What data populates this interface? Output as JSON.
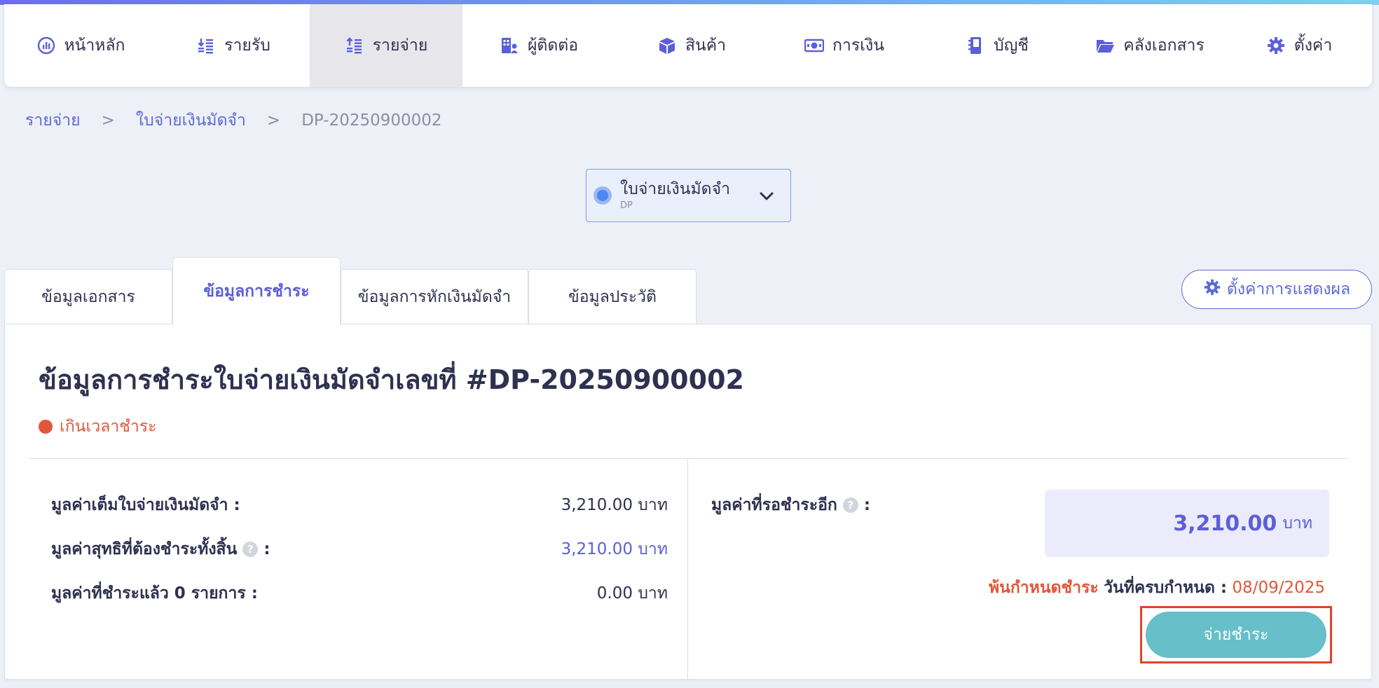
{
  "colors": {
    "accent": "#5b5fd9",
    "link": "#5b6ad6",
    "overdue": "#e0573a",
    "pay_button": "#67bfc9",
    "highlight_frame": "#e0442a",
    "active_nav_bg": "#e6e6eb"
  },
  "nav": {
    "items": [
      {
        "label": "หน้าหลัก",
        "icon": "dashboard-icon"
      },
      {
        "label": "รายรับ",
        "icon": "income-icon"
      },
      {
        "label": "รายจ่าย",
        "icon": "expense-icon",
        "active": true
      },
      {
        "label": "ผู้ติดต่อ",
        "icon": "contacts-icon"
      },
      {
        "label": "สินค้า",
        "icon": "product-box-icon"
      },
      {
        "label": "การเงิน",
        "icon": "money-icon"
      },
      {
        "label": "บัญชี",
        "icon": "account-book-icon"
      },
      {
        "label": "คลังเอกสาร",
        "icon": "folder-icon"
      },
      {
        "label": "ตั้งค่า",
        "icon": "gear-icon"
      }
    ]
  },
  "breadcrumb": {
    "level1": "รายจ่าย",
    "level2": "ใบจ่ายเงินมัดจำ",
    "current": "DP-20250900002",
    "separator": ">"
  },
  "doc_type_select": {
    "label": "ใบจ่ายเงินมัดจำ",
    "code": "DP",
    "icon": "chevron-down-icon"
  },
  "tabs": [
    {
      "label": "ข้อมูลเอกสาร"
    },
    {
      "label": "ข้อมูลการชำระ",
      "active": true
    },
    {
      "label": "ข้อมูลการหักเงินมัดจำ"
    },
    {
      "label": "ข้อมูลประวัติ"
    }
  ],
  "display_settings": {
    "label": "ตั้งค่าการแสดงผล",
    "icon": "gear-icon"
  },
  "payment": {
    "title": "ข้อมูลการชำระใบจ่ายเงินมัดจำเลขที่ #DP-20250900002",
    "status": "เกินเวลาชำระ",
    "rows": [
      {
        "label": "มูลค่าเต็มใบจ่ายเงินมัดจำ :",
        "value": "3,210.00 บาท"
      },
      {
        "label": "มูลค่าสุทธิที่ต้องชำระทั้งสิ้น",
        "suffix": ":",
        "value": "3,210.00 บาท",
        "help": "?"
      },
      {
        "label": "มูลค่าที่ชำระแล้ว 0 รายการ :",
        "value": "0.00 บาท"
      }
    ],
    "remaining_label": "มูลค่าที่รอชำระอีก",
    "remaining_suffix": ":",
    "remaining_help": "?",
    "remaining_amount": "3,210.00",
    "remaining_unit": "บาท",
    "overdue_text": "พ้นกำหนดชำระ",
    "due_label": "วันที่ครบกำหนด :",
    "due_date": "08/09/2025",
    "pay_button_label": "จ่ายชำระ"
  }
}
